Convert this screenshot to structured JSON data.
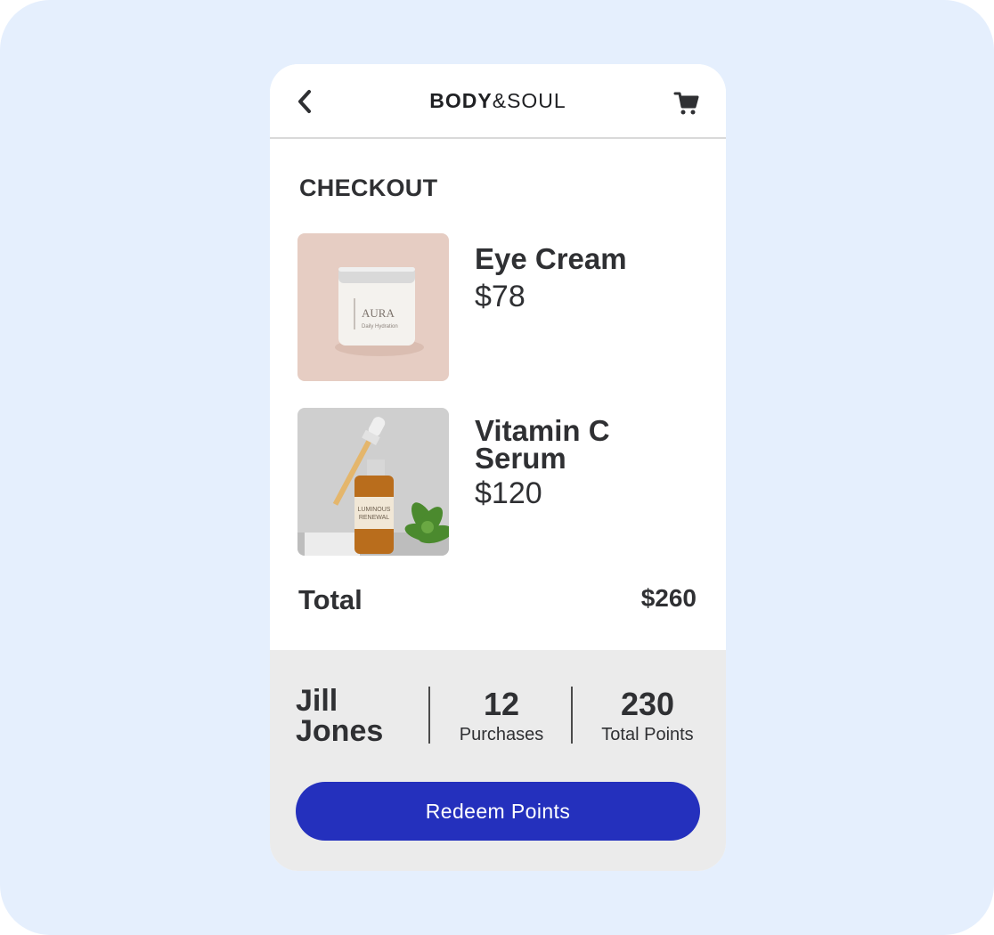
{
  "header": {
    "brand_bold": "BODY",
    "brand_light": "&SOUL",
    "back_icon": "chevron-left-icon",
    "cart_icon": "shopping-cart-icon"
  },
  "checkout": {
    "title": "CHECKOUT",
    "items": [
      {
        "name": "Eye Cream",
        "price": "$78",
        "jar_label_brand": "AURA",
        "jar_label_sub": "Daily Hydration"
      },
      {
        "name": "Vitamin C Serum",
        "price": "$120",
        "bottle_label_1": "LUMINOUS",
        "bottle_label_2": "RENEWAL"
      }
    ],
    "total_label": "Total",
    "total_value": "$260"
  },
  "profile": {
    "name": "Jill Jones",
    "purchases_count": "12",
    "purchases_label": "Purchases",
    "points_count": "230",
    "points_label": "Total Points"
  },
  "actions": {
    "redeem_label": "Redeem Points"
  },
  "colors": {
    "background": "#e5effd",
    "primary_button": "#2430bd",
    "footer_bg": "#ebebeb",
    "text": "#2f3033"
  }
}
